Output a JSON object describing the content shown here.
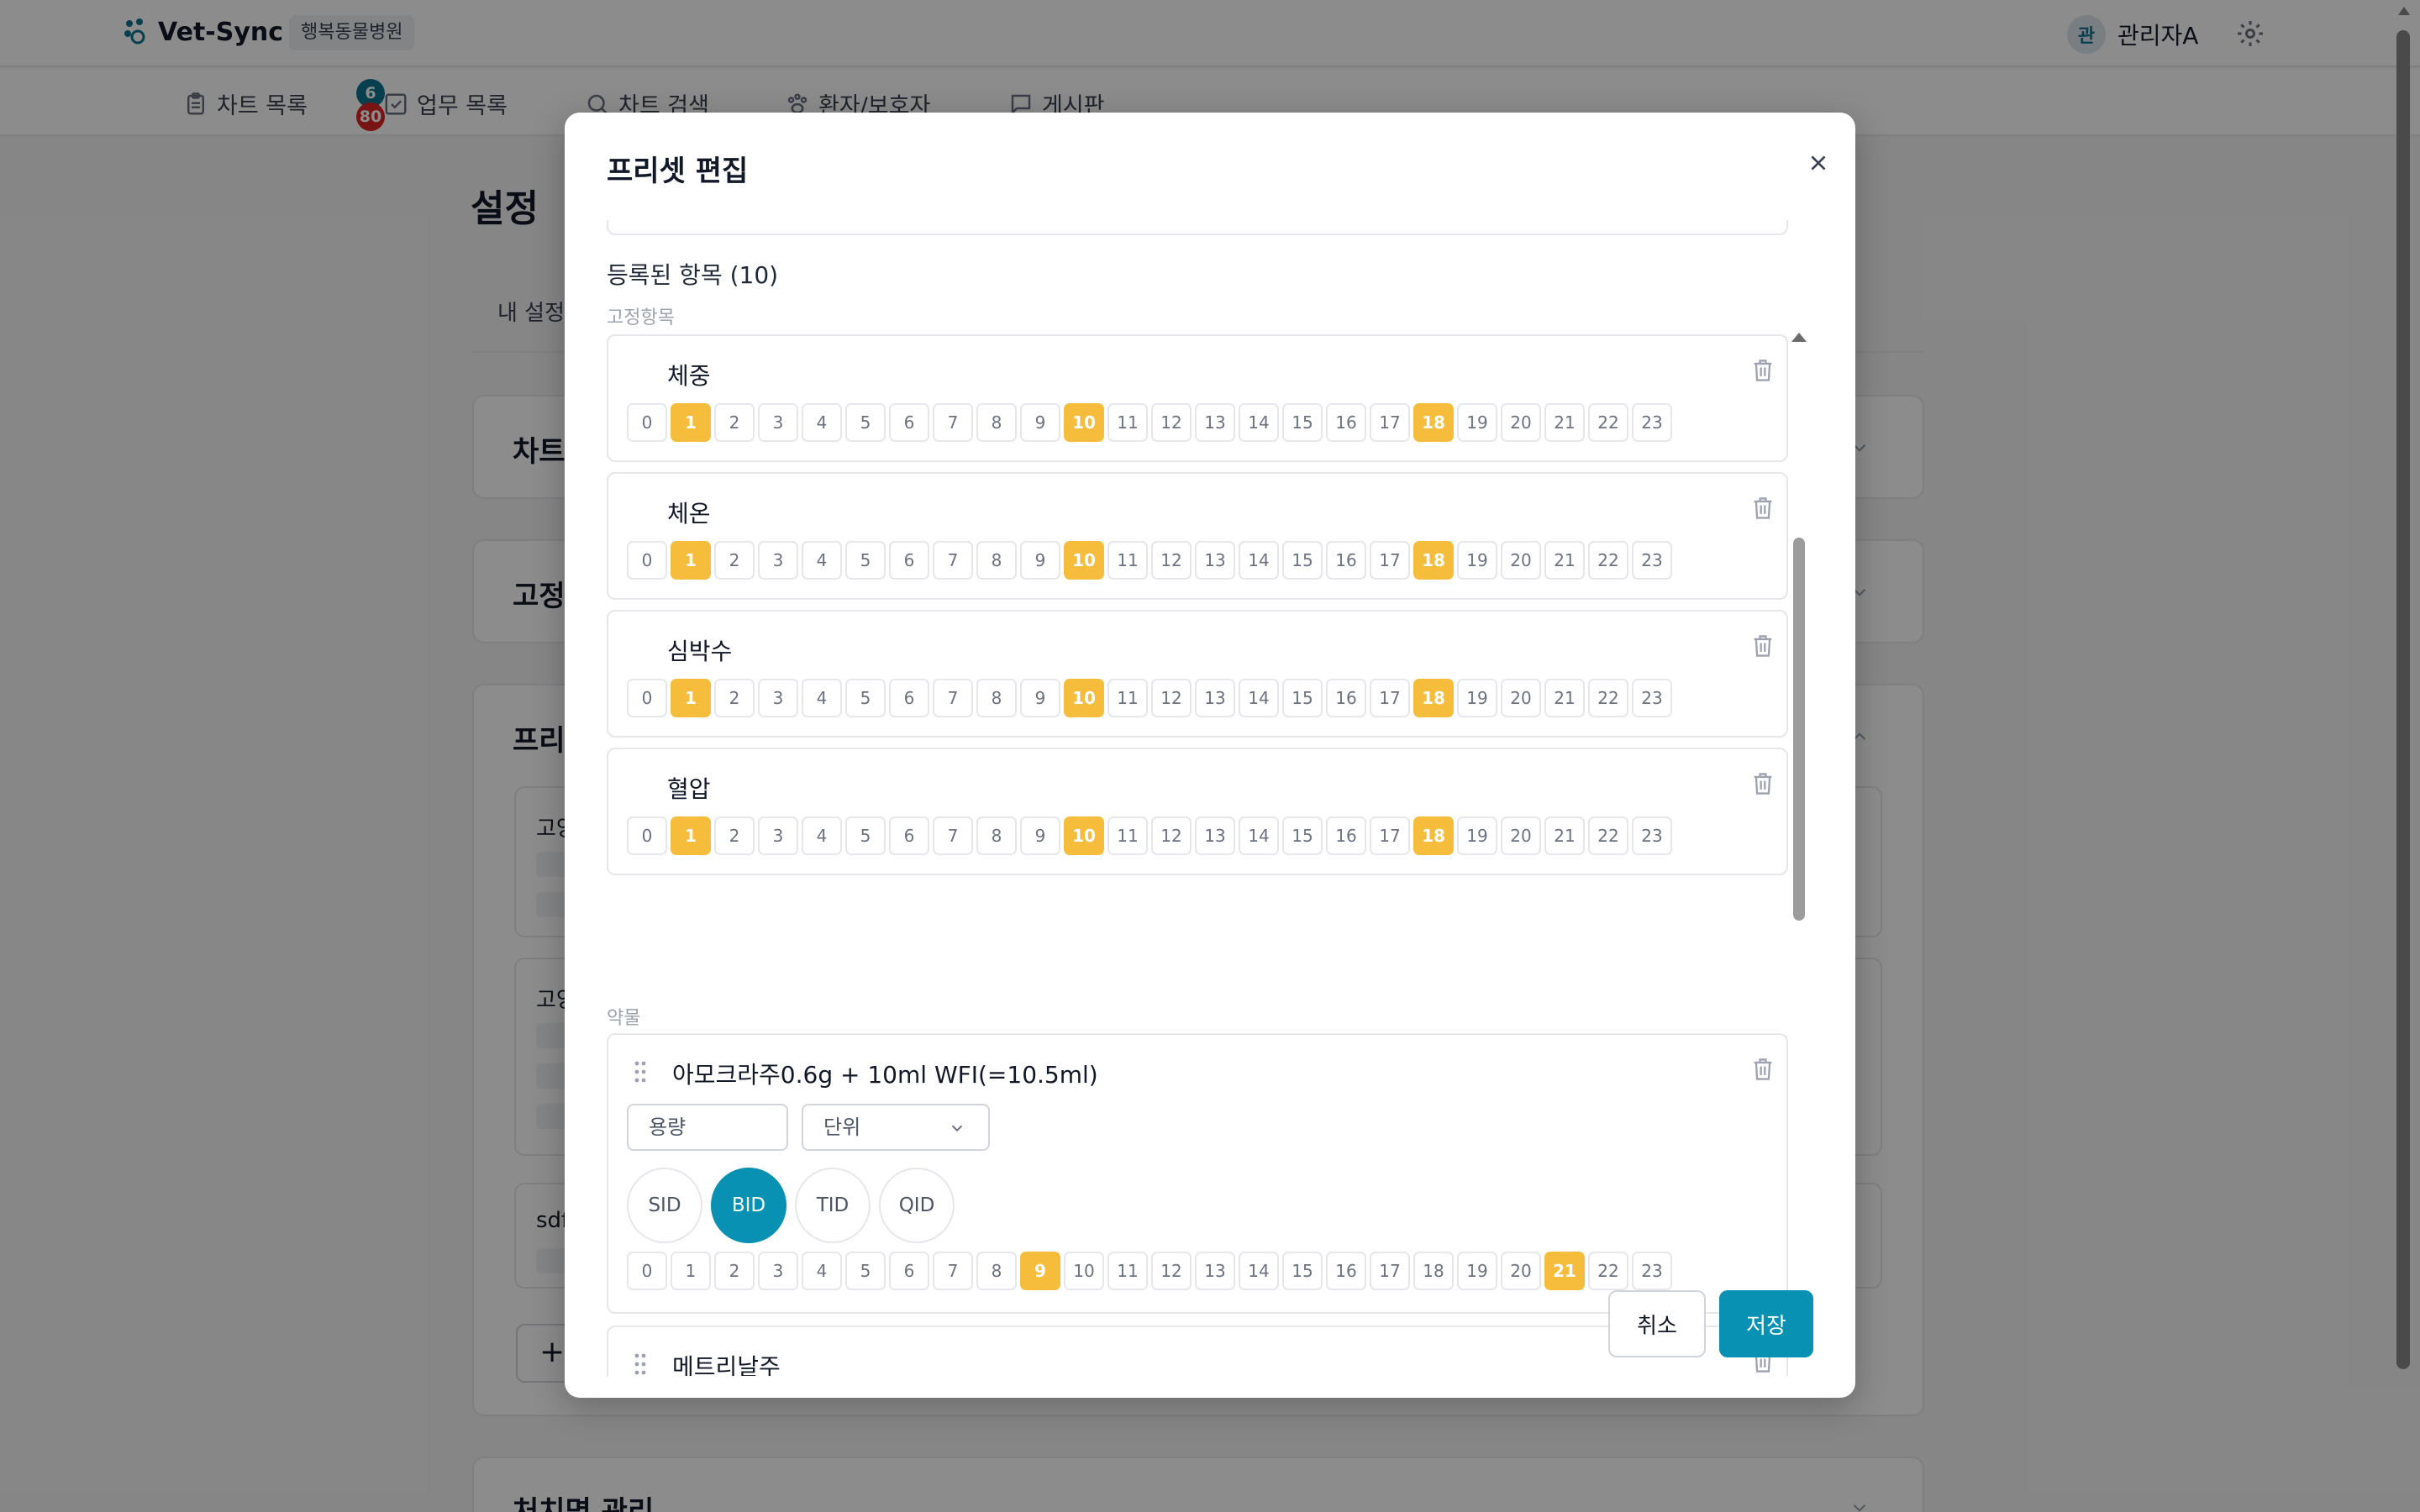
{
  "app": {
    "logo_text": "Vet-Sync",
    "hospital": "행복동물병원",
    "user_avatar": "관",
    "user_name": "관리자A"
  },
  "nav": {
    "items": [
      {
        "label": "차트 목록",
        "icon": "clipboard-icon"
      },
      {
        "label": "업무 목록",
        "icon": "checklist-icon"
      },
      {
        "label": "차트 검색",
        "icon": "search-icon"
      },
      {
        "label": "환자/보호자",
        "icon": "paw-icon"
      },
      {
        "label": "게시판",
        "icon": "message-icon"
      }
    ],
    "badge_blue": "6",
    "badge_red": "80"
  },
  "page": {
    "title": "설정",
    "tab": "내 설정",
    "sections": [
      "차트",
      "고정",
      "프리",
      "처치명 관리"
    ],
    "preset_cards": [
      "고양",
      "고양",
      "sdf"
    ],
    "add_button": "+"
  },
  "modal": {
    "title": "프리셋 편집",
    "items_heading": "등록된 항목 (10)",
    "group_fixed": "고정항목",
    "group_drug": "약물",
    "hours": [
      "0",
      "1",
      "2",
      "3",
      "4",
      "5",
      "6",
      "7",
      "8",
      "9",
      "10",
      "11",
      "12",
      "13",
      "14",
      "15",
      "16",
      "17",
      "18",
      "19",
      "20",
      "21",
      "22",
      "23"
    ],
    "fixed_items": [
      {
        "name": "체중",
        "selected_hours": [
          1,
          10,
          18
        ]
      },
      {
        "name": "체온",
        "selected_hours": [
          1,
          10,
          18
        ]
      },
      {
        "name": "심박수",
        "selected_hours": [
          1,
          10,
          18
        ]
      },
      {
        "name": "혈압",
        "selected_hours": [
          1,
          10,
          18
        ]
      }
    ],
    "drug_items": [
      {
        "name": "아모크라주0.6g + 10ml WFI(=10.5ml)",
        "dose_placeholder": "용량",
        "unit_select": "단위",
        "frequencies": [
          "SID",
          "BID",
          "TID",
          "QID"
        ],
        "selected_frequency": "BID",
        "selected_hours": [
          9,
          21
        ]
      },
      {
        "name": "메트리날주"
      }
    ],
    "cancel_label": "취소",
    "save_label": "저장"
  },
  "colors": {
    "accent": "#0891b2",
    "hour_selected": "#f6bd3c",
    "badge_blue": "#0e7490",
    "badge_red": "#dc2626"
  }
}
